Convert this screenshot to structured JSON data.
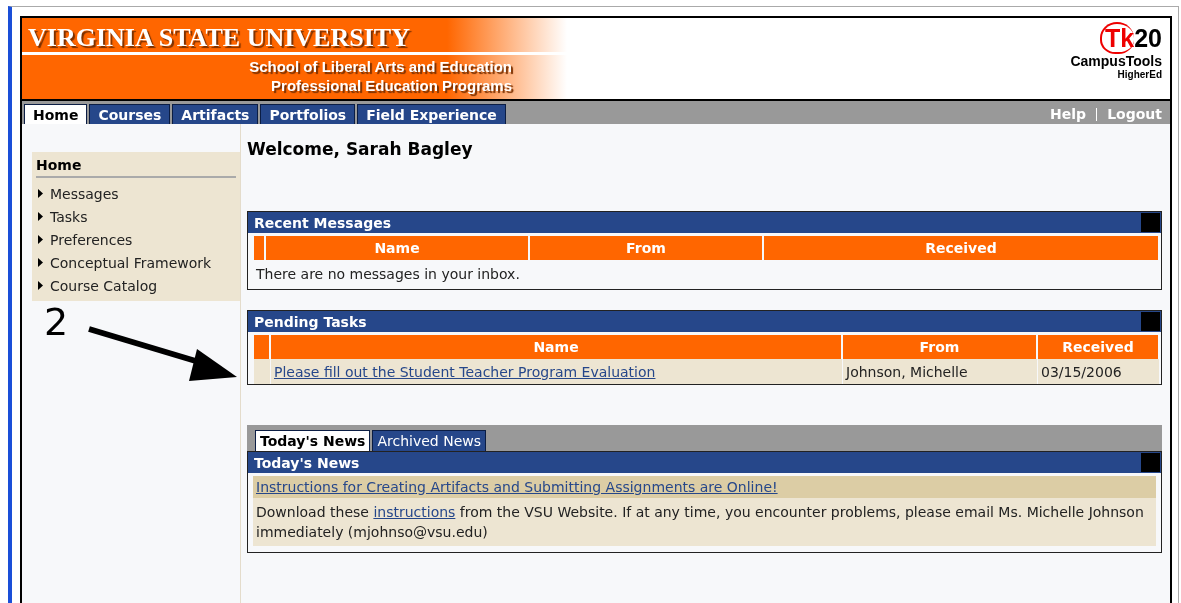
{
  "header": {
    "university": "VIRGINIA STATE UNIVERSITY",
    "school": "School of Liberal Arts and Education",
    "program": "Professional Education Programs",
    "logo": {
      "brand_a": "Tk",
      "brand_b": "20",
      "product": "CampusTools",
      "edition": "HigherEd"
    }
  },
  "tabs": [
    {
      "label": "Home",
      "selected": true
    },
    {
      "label": "Courses",
      "selected": false
    },
    {
      "label": "Artifacts",
      "selected": false
    },
    {
      "label": "Portfolios",
      "selected": false
    },
    {
      "label": "Field Experience",
      "selected": false
    }
  ],
  "top_links": [
    "Help",
    "Logout"
  ],
  "sidebar": {
    "title": "Home",
    "items": [
      "Messages",
      "Tasks",
      "Preferences",
      "Conceptual Framework",
      "Course Catalog"
    ]
  },
  "annotation": {
    "number": "2"
  },
  "welcome": "Welcome, Sarah Bagley",
  "recent_messages": {
    "title": "Recent Messages",
    "columns": [
      "Name",
      "From",
      "Received"
    ],
    "empty_text": "There are no messages in your inbox."
  },
  "pending_tasks": {
    "title": "Pending Tasks",
    "columns": [
      "Name",
      "From",
      "Received"
    ],
    "rows": [
      {
        "name": "Please fill out the Student Teacher Program Evaluation",
        "from": "Johnson, Michelle",
        "received": "03/15/2006"
      }
    ]
  },
  "news_tabs": [
    {
      "label": "Today's News",
      "selected": true
    },
    {
      "label": "Archived News",
      "selected": false
    }
  ],
  "news": {
    "title": "Today's News",
    "headline": "Instructions for Creating Artifacts and Submitting Assignments are Online!",
    "body_before": "Download these",
    "body_link": "instructions",
    "body_after": "from the VSU Website. If at any time, you encounter problems, please email Ms. Michelle Johnson immediately (mjohnso@vsu.edu)"
  }
}
